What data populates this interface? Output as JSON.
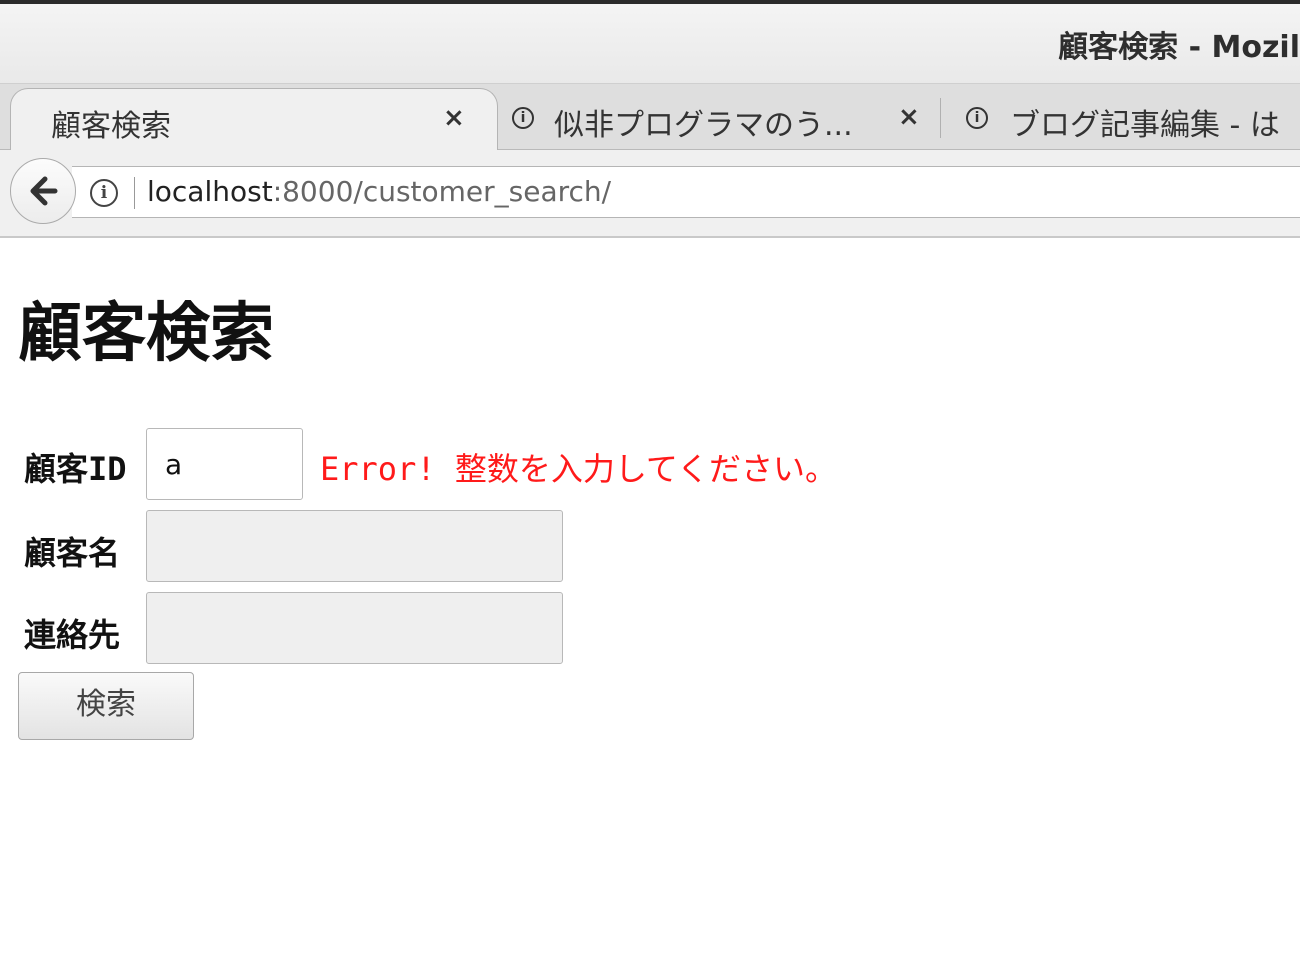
{
  "window": {
    "title": "顧客検索  -  Mozil"
  },
  "tabs": [
    {
      "label": "顧客検索",
      "close": "×",
      "active": true
    },
    {
      "label": "似非プログラマのう...",
      "close": "×",
      "active": false,
      "icon": "info-icon"
    },
    {
      "label": "ブログ記事編集 - は",
      "active": false,
      "icon": "info-icon"
    }
  ],
  "navbar": {
    "back_icon": "🡐",
    "info_icon": "i",
    "url_host": "localhost",
    "url_rest": ":8000/customer_search/"
  },
  "page": {
    "heading": "顧客検索",
    "form": {
      "customer_id_label": "顧客ID",
      "customer_id_value": "a",
      "customer_id_error": "Error! 整数を入力してください。",
      "customer_name_label": "顧客名",
      "customer_name_value": "",
      "contact_label": "連絡先",
      "contact_value": "",
      "submit_label": "検索"
    }
  },
  "colors": {
    "error": "#ff1a1a",
    "disabled_field_bg": "#efefef"
  }
}
